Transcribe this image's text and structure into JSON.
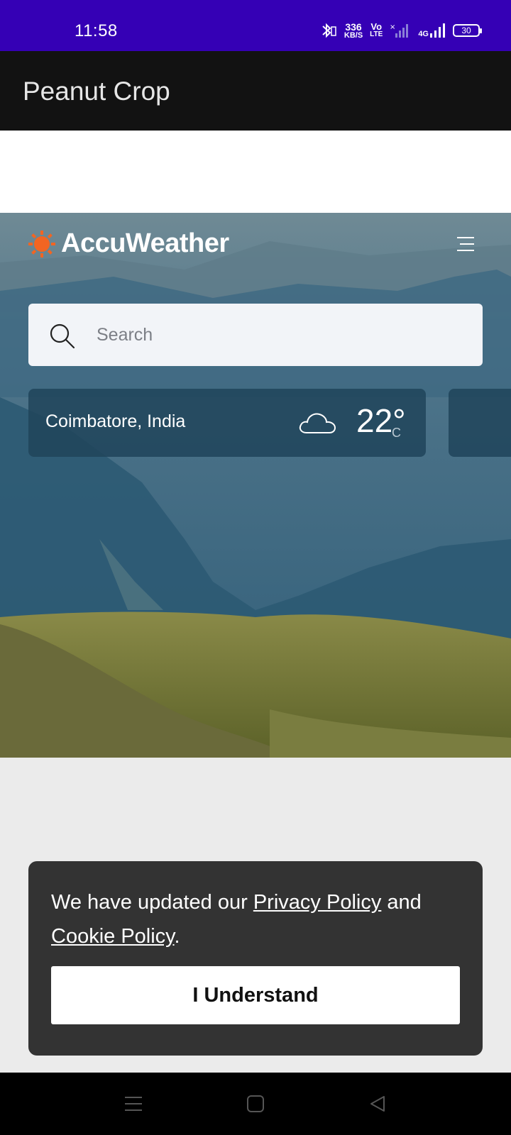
{
  "status_bar": {
    "time": "11:58",
    "net_speed_value": "336",
    "net_speed_unit": "KB/S",
    "volte_top": "Vo",
    "volte_bottom": "LTE",
    "network": "4G",
    "battery": "30",
    "icons": [
      "bluetooth-icon",
      "signal-icon",
      "battery-icon"
    ]
  },
  "app_bar": {
    "title": "Peanut Crop"
  },
  "accuweather": {
    "logo_text": "AccuWeather",
    "brand_color": "#f26522",
    "search_placeholder": "Search",
    "location_card": {
      "location": "Coimbatore, India",
      "temperature": "22°",
      "unit": "C",
      "condition_icon": "cloud-icon"
    }
  },
  "cookie_notice": {
    "text_before": "We have updated our",
    "privacy_link": "Privacy Policy",
    "text_middle": "and",
    "cookie_link": "Cookie Policy",
    "text_end": ".",
    "button_label": "I Understand"
  },
  "nav_bar": {
    "buttons": [
      "menu-icon",
      "home-icon",
      "back-icon"
    ]
  }
}
